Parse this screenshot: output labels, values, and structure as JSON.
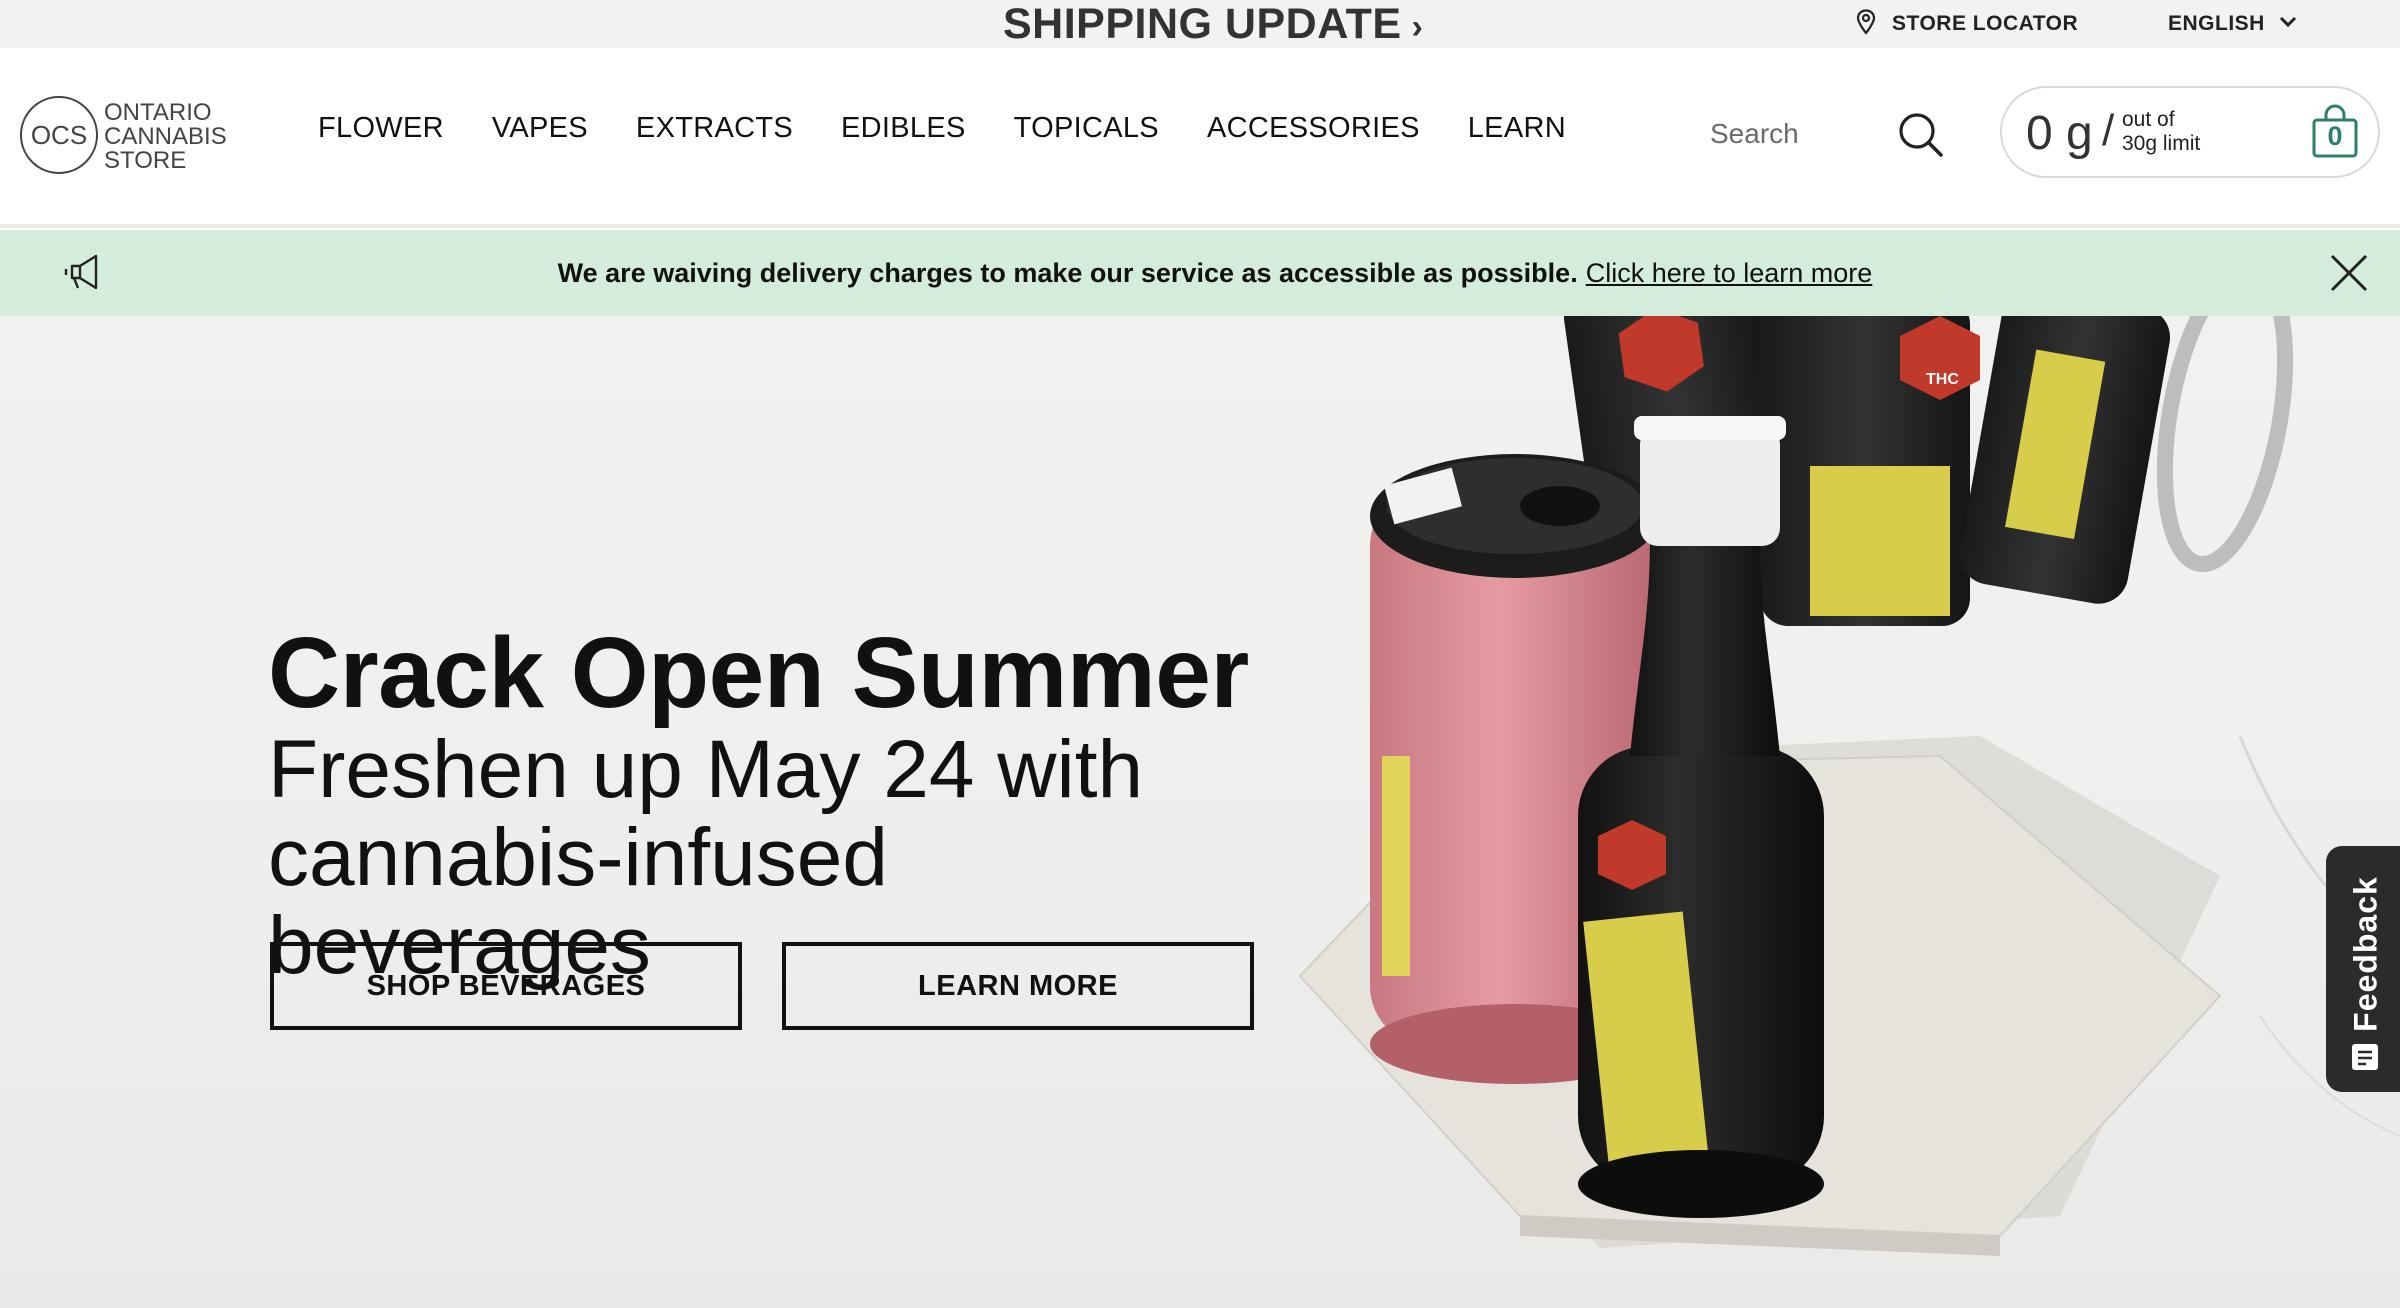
{
  "topbar": {
    "shipping_label": "SHIPPING UPDATE",
    "shipping_chevron": "›",
    "store_locator_label": "STORE LOCATOR",
    "language_label": "ENGLISH"
  },
  "header": {
    "logo": {
      "initials": "OCS",
      "line1": "ONTARIO",
      "line2": "CANNABIS",
      "line3": "STORE"
    },
    "nav": [
      "FLOWER",
      "VAPES",
      "EXTRACTS",
      "EDIBLES",
      "TOPICALS",
      "ACCESSORIES",
      "LEARN"
    ],
    "search": {
      "placeholder": "Search",
      "value": ""
    },
    "limit": {
      "amount": "0 g",
      "slash": "/",
      "line1": "out of",
      "line2": "30g limit"
    },
    "cart": {
      "count": "0"
    }
  },
  "notice": {
    "message": "We are waiving delivery charges to make our service as accessible as possible.",
    "link": "Click here to learn more"
  },
  "hero": {
    "title": "Crack Open Summer",
    "subtitle_line1": "Freshen up May 24 with",
    "subtitle_line2": "cannabis-infused beverages",
    "buttons": {
      "shop": "SHOP BEVERAGES",
      "learn": "LEARN MORE"
    },
    "art_label": "THC"
  },
  "feedback": {
    "label": "Feedback"
  },
  "colors": {
    "notice_bg": "#d4ecdc",
    "cart_accent": "#2e7d6b",
    "topbar_bg": "#f2f2f2",
    "feedback_bg": "#2b2b2b",
    "can_pink": "#dc8a92",
    "bottle_black": "#1e1e1e",
    "label_yellow": "#d8cd4a"
  }
}
